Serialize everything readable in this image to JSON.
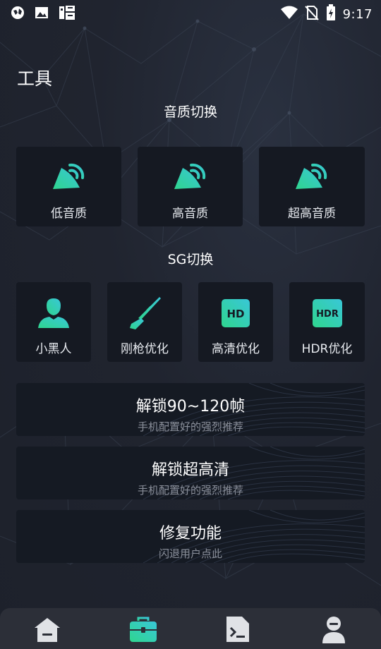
{
  "status_bar": {
    "time": "9:17",
    "left_icons": [
      "vpn-globe-icon",
      "image-icon",
      "app-notification-icon"
    ],
    "right_icons": [
      "wifi-icon",
      "no-sim-icon",
      "battery-charging-icon"
    ]
  },
  "page": {
    "title": "工具"
  },
  "audio_section": {
    "title": "音质切换",
    "items": [
      {
        "label": "低音质",
        "icon": "speaker-icon"
      },
      {
        "label": "高音质",
        "icon": "speaker-icon"
      },
      {
        "label": "超高音质",
        "icon": "speaker-icon"
      }
    ]
  },
  "sg_section": {
    "title": "SG切换",
    "items": [
      {
        "label": "小黑人",
        "icon": "person-icon"
      },
      {
        "label": "刚枪优化",
        "icon": "rifle-icon"
      },
      {
        "label": "高清优化",
        "icon": "hd-icon"
      },
      {
        "label": "HDR优化",
        "icon": "hdr-icon"
      }
    ],
    "hd_badge": "HD",
    "hdr_badge": "HDR"
  },
  "actions": [
    {
      "title": "解锁90~120帧",
      "subtitle": "手机配置好的强烈推荐"
    },
    {
      "title": "解锁超高清",
      "subtitle": "手机配置好的强烈推荐"
    },
    {
      "title": "修复功能",
      "subtitle": "闪退用户点此"
    }
  ],
  "bottom_nav": {
    "items": [
      "home-icon",
      "toolbox-icon",
      "terminal-icon",
      "profile-icon"
    ],
    "active": "toolbox-icon"
  },
  "colors": {
    "accent_start": "#2fd58e",
    "accent_end": "#39c7d8",
    "background": "#20242f",
    "card": "#151922",
    "nav_icon": "#e0e2e6"
  }
}
